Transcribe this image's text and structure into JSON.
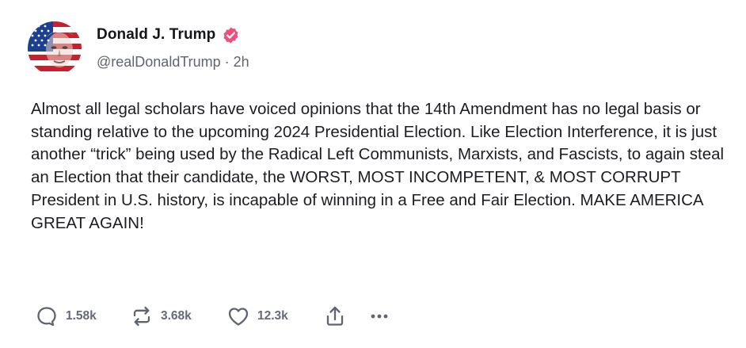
{
  "post": {
    "author": {
      "display_name": "Donald J. Trump",
      "handle": "@realDonaldTrump",
      "verified": true,
      "verified_color": "#f04e7c"
    },
    "separator": "·",
    "time_ago": "2h",
    "text": "Almost all legal scholars have voiced opinions that the 14th Amendment has no legal basis or standing relative to the upcoming 2024 Presidential Election. Like Election Interference, it is just another “trick” being used by the Radical Left Communists, Marxists, and Fascists, to again steal an Election that their candidate, the WORST, MOST INCOMPETENT, & MOST CORRUPT President in U.S. history, is incapable of winning in a Free and Fair Election. MAKE AMERICA GREAT AGAIN!",
    "actions": {
      "replies": "1.58k",
      "retruths": "3.68k",
      "likes": "12.3k"
    },
    "icons": {
      "reply": "reply-bubble-icon",
      "retruth": "retruth-arrows-icon",
      "like": "heart-icon",
      "share": "share-upload-icon",
      "more": "more-ellipsis-icon"
    },
    "colors": {
      "text": "#1c1c22",
      "muted": "#5f6470"
    }
  }
}
